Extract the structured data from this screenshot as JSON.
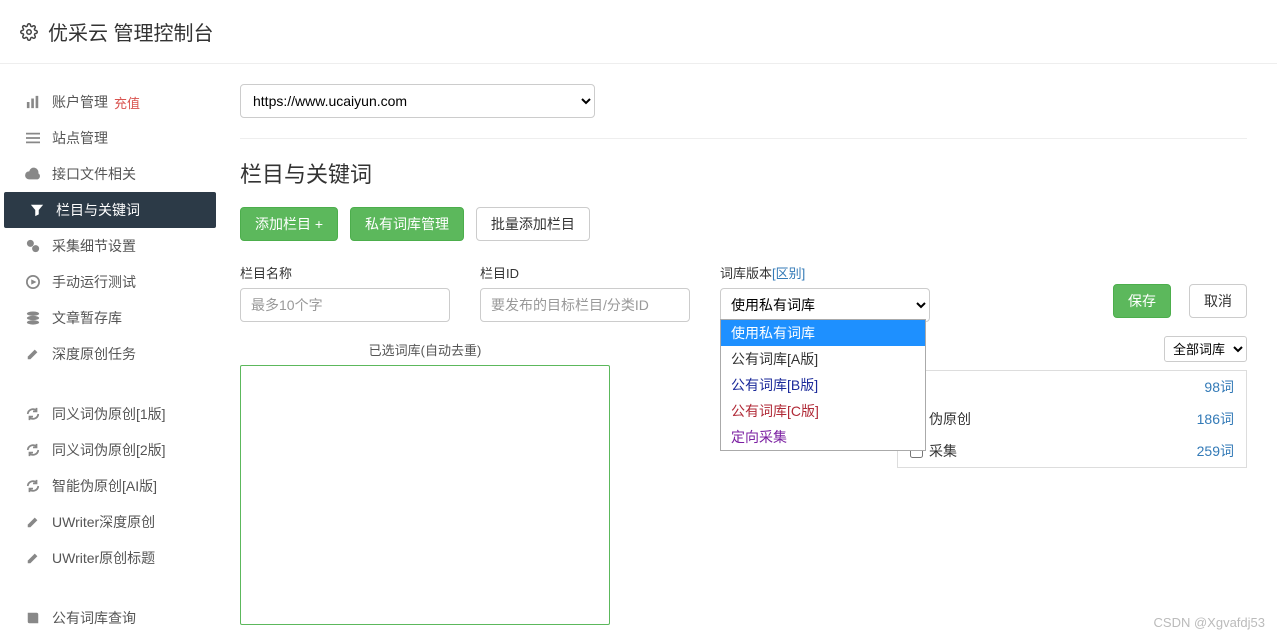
{
  "header": {
    "title": "优采云 管理控制台"
  },
  "sidebar": {
    "items": [
      {
        "label": "账户管理",
        "icon": "bar-chart-icon",
        "extra": "充值"
      },
      {
        "label": "站点管理",
        "icon": "list-icon"
      },
      {
        "label": "接口文件相关",
        "icon": "cloud-icon"
      },
      {
        "label": "栏目与关键词",
        "icon": "filter-icon",
        "active": true
      },
      {
        "label": "采集细节设置",
        "icon": "gears-icon"
      },
      {
        "label": "手动运行测试",
        "icon": "play-icon"
      },
      {
        "label": "文章暂存库",
        "icon": "stack-icon"
      },
      {
        "label": "深度原创任务",
        "icon": "edit-icon"
      }
    ],
    "group2": [
      {
        "label": "同义词伪原创[1版]",
        "icon": "refresh-icon"
      },
      {
        "label": "同义词伪原创[2版]",
        "icon": "refresh-icon"
      },
      {
        "label": "智能伪原创[AI版]",
        "icon": "refresh-icon"
      },
      {
        "label": "UWriter深度原创",
        "icon": "edit-icon"
      },
      {
        "label": "UWriter原创标题",
        "icon": "edit-icon"
      }
    ],
    "group3": [
      {
        "label": "公有词库查询",
        "icon": "book-icon"
      }
    ]
  },
  "main": {
    "url_option": "https://www.ucaiyun.com",
    "section_title": "栏目与关键词",
    "buttons": {
      "add_column": "添加栏目 +",
      "private_lexicon": "私有词库管理",
      "batch_add": "批量添加栏目"
    },
    "fields": {
      "name_label": "栏目名称",
      "name_placeholder": "最多10个字",
      "id_label": "栏目ID",
      "id_placeholder": "要发布的目标栏目/分类ID",
      "version_label": "词库版本",
      "version_link": "[区别]",
      "version_value": "使用私有词库"
    },
    "version_options": [
      {
        "label": "使用私有词库",
        "cls": "sel"
      },
      {
        "label": "公有词库[A版]",
        "cls": ""
      },
      {
        "label": "公有词库[B版]",
        "cls": "c-b"
      },
      {
        "label": "公有词库[C版]",
        "cls": "c-c"
      },
      {
        "label": "定向采集",
        "cls": "c-d"
      }
    ],
    "actions": {
      "save": "保存",
      "cancel": "取消"
    },
    "lower": {
      "left_caption": "已选词库(自动去重)",
      "right_filter": "全部词库",
      "categories": [
        {
          "label": "",
          "count": "98词",
          "label_text": ""
        },
        {
          "label": "伪原创",
          "count": "186词"
        },
        {
          "label": "采集",
          "count": "259词"
        }
      ]
    }
  },
  "watermark": "CSDN @Xgvafdj53"
}
